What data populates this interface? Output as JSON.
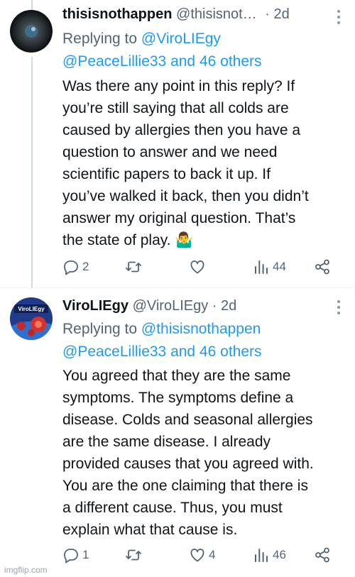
{
  "tweets": [
    {
      "name": "thisisnothappen",
      "handle": "@thisisnot…",
      "time": "· 2d",
      "replying_prefix": "Replying to ",
      "mention1": "@ViroLIEgy",
      "mention2": "@PeaceLillie33 and 46 others",
      "body": [
        "Was there any point in this reply? If",
        "you’re still saying that all colds are",
        "caused by allergies then you have a",
        "question to answer and we need",
        "scientific papers to back it up. If",
        "you’ve walked it back, then you didn’t",
        "answer my original question. That’s",
        "the state of play. 🤷‍♂️"
      ],
      "replies": "2",
      "retweets": "",
      "likes": "",
      "views": "44"
    },
    {
      "name": "ViroLIEgy",
      "handle": "@ViroLIEgy",
      "time": "· 2d",
      "avatar_text": "ViroLIEgy",
      "replying_prefix": "Replying to ",
      "mention1": "@thisisnothappen",
      "mention2": "@PeaceLillie33 and 46 others",
      "body": [
        "You agreed that they are the same",
        "symptoms. The symptoms define a",
        "disease. Colds and seasonal allergies",
        "are the same disease. I already",
        "provided causes that you agreed with.",
        "You are the one claiming that there is",
        "a different cause. Thus, you must",
        "explain what that cause is."
      ],
      "replies": "1",
      "retweets": "",
      "likes": "4",
      "views": "46"
    }
  ],
  "watermark": "imgflip.com",
  "colors": {
    "text": "#0f1419",
    "secondary": "#536471",
    "link": "#1d9bf0"
  },
  "icons": [
    "reply-icon",
    "retweet-icon",
    "like-icon",
    "views-icon",
    "share-icon",
    "more-icon"
  ]
}
